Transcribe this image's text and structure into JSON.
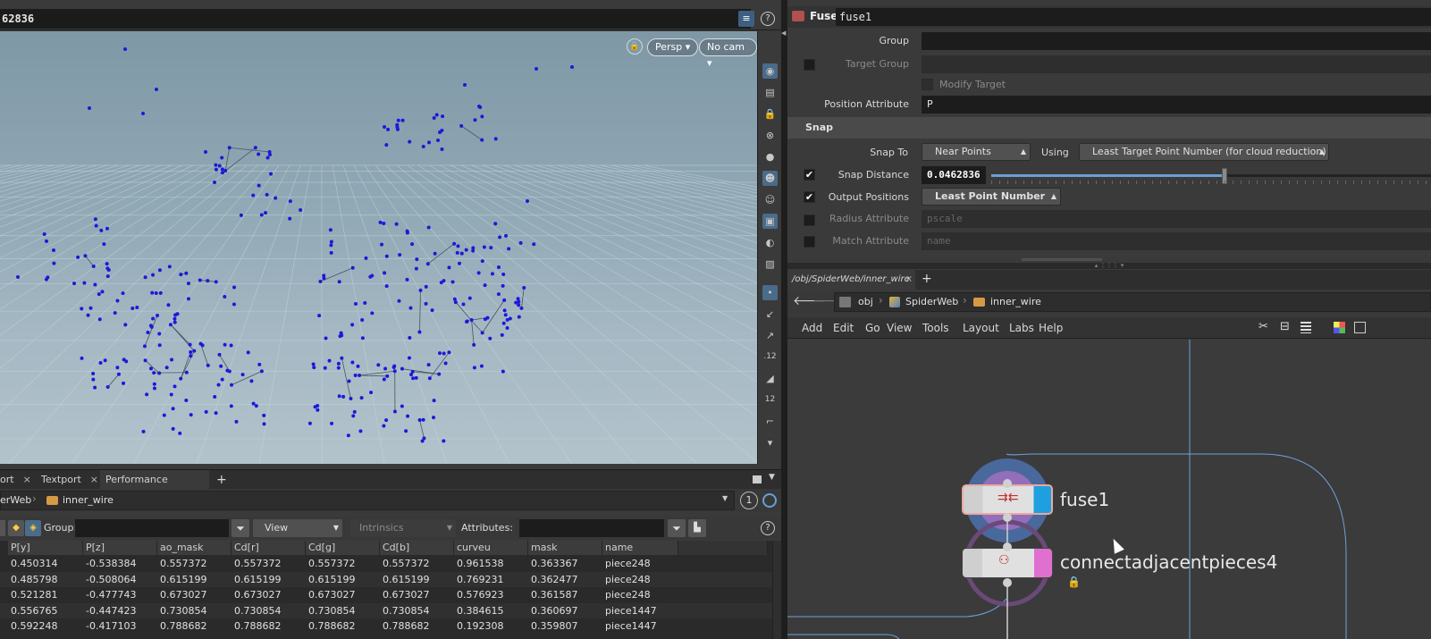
{
  "viewport": {
    "value_field": "62836",
    "persp_label": "Persp ▾",
    "cam_label": "No cam ▾"
  },
  "bottom_tabs": [
    {
      "label": "ort"
    },
    {
      "label": "Textport"
    },
    {
      "label": "Performance Monitor"
    }
  ],
  "bottom_path": {
    "crumb1": "erWeb",
    "crumb2": "inner_wire",
    "badge": "1"
  },
  "spreadsheet": {
    "group_label": "Group:",
    "view_label": "View",
    "intrinsics_label": "Intrinsics",
    "attributes_label": "Attributes:",
    "columns": [
      "P[y]",
      "P[z]",
      "ao_mask",
      "Cd[r]",
      "Cd[g]",
      "Cd[b]",
      "curveu",
      "mask",
      "name"
    ],
    "rows": [
      [
        "0.450314",
        "-0.538384",
        "0.557372",
        "0.557372",
        "0.557372",
        "0.557372",
        "0.961538",
        "0.363367",
        "piece248"
      ],
      [
        "0.485798",
        "-0.508064",
        "0.615199",
        "0.615199",
        "0.615199",
        "0.615199",
        "0.769231",
        "0.362477",
        "piece248"
      ],
      [
        "0.521281",
        "-0.477743",
        "0.673027",
        "0.673027",
        "0.673027",
        "0.673027",
        "0.576923",
        "0.361587",
        "piece248"
      ],
      [
        "0.556765",
        "-0.447423",
        "0.730854",
        "0.730854",
        "0.730854",
        "0.730854",
        "0.384615",
        "0.360697",
        "piece1447"
      ],
      [
        "0.592248",
        "-0.417103",
        "0.788682",
        "0.788682",
        "0.788682",
        "0.788682",
        "0.192308",
        "0.359807",
        "piece1447"
      ]
    ]
  },
  "parms": {
    "node_type": "Fuse",
    "node_name": "fuse1",
    "group_label": "Group",
    "target_group_label": "Target Group",
    "modify_target_label": "Modify Target",
    "position_attr_label": "Position Attribute",
    "position_attr_value": "P",
    "snap_section": "Snap",
    "snap_to_label": "Snap To",
    "snap_to_value": "Near Points",
    "using_label": "Using",
    "using_value": "Least Target Point Number (for cloud reduction)",
    "snap_distance_label": "Snap Distance",
    "snap_distance_value": "0.0462836",
    "snap_distance_fraction": 0.53,
    "output_positions_label": "Output Positions",
    "output_positions_value": "Least Point Number",
    "radius_attr_label": "Radius Attribute",
    "radius_attr_placeholder": "pscale",
    "match_attr_label": "Match Attribute",
    "match_attr_placeholder": "name"
  },
  "network": {
    "tab_label": "/obj/SpiderWeb/inner_wire",
    "path": [
      "obj",
      "SpiderWeb",
      "inner_wire"
    ],
    "menu": [
      "Add",
      "Edit",
      "Go",
      "View",
      "Tools",
      "Layout",
      "Labs",
      "Help"
    ],
    "nodes": [
      {
        "name": "fuse1"
      },
      {
        "name": "connectadjacentpieces4"
      }
    ]
  }
}
